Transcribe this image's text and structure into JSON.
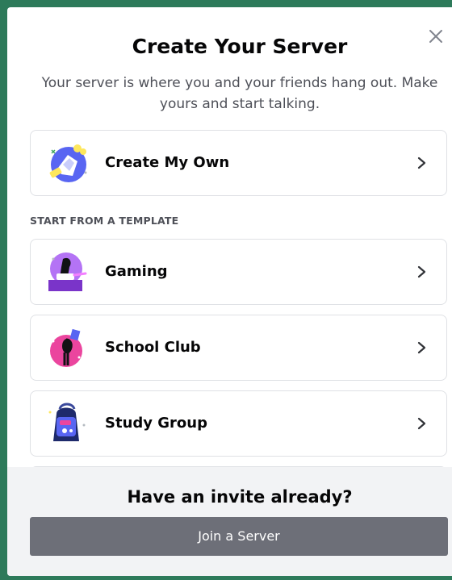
{
  "modal": {
    "title": "Create Your Server",
    "subtitle": "Your server is where you and your friends hang out. Make yours and start talking.",
    "close_icon": "close-icon"
  },
  "create_own": {
    "label": "Create My Own",
    "icon": "create-server-icon"
  },
  "template_section": {
    "header": "START FROM A TEMPLATE",
    "items": [
      {
        "label": "Gaming",
        "icon": "gaming-icon"
      },
      {
        "label": "School Club",
        "icon": "school-club-icon"
      },
      {
        "label": "Study Group",
        "icon": "study-group-icon"
      }
    ]
  },
  "footer": {
    "title": "Have an invite already?",
    "join_label": "Join a Server"
  },
  "colors": {
    "backdrop": "#2d7a5a",
    "footer_bg": "#f2f3f5",
    "button_bg": "#6d6f78"
  }
}
